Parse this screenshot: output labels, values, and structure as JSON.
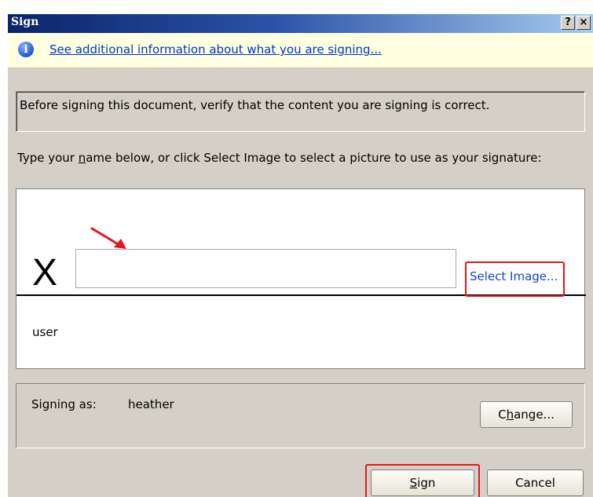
{
  "window": {
    "title": "Sign",
    "help_button": "?",
    "close_button": "×"
  },
  "info_bar": {
    "link_text": "See additional information about what you are signing..."
  },
  "verify_message": "Before signing this document, verify that the content you are signing is correct.",
  "instruction": {
    "before": "Type your ",
    "mnemonic": "n",
    "after": "ame below, or click Select Image to select a picture to use as your signature:"
  },
  "signature": {
    "x_mark": "X",
    "name_value": "",
    "select_image_label": "Select Image...",
    "signer_caption": "user"
  },
  "signing_as": {
    "label": "Signing as:",
    "name": "heather",
    "change_button": {
      "before": "C",
      "mnemonic": "h",
      "after": "ange..."
    }
  },
  "buttons": {
    "sign": {
      "mnemonic": "S",
      "after": "ign"
    },
    "cancel": "Cancel"
  },
  "colors": {
    "highlight": "#e8151a",
    "link": "#0033cc",
    "info_background": "#ffffe1",
    "dialog_background": "#d4d0c8"
  },
  "icons": [
    "info-icon",
    "red-arrow-pointer"
  ]
}
